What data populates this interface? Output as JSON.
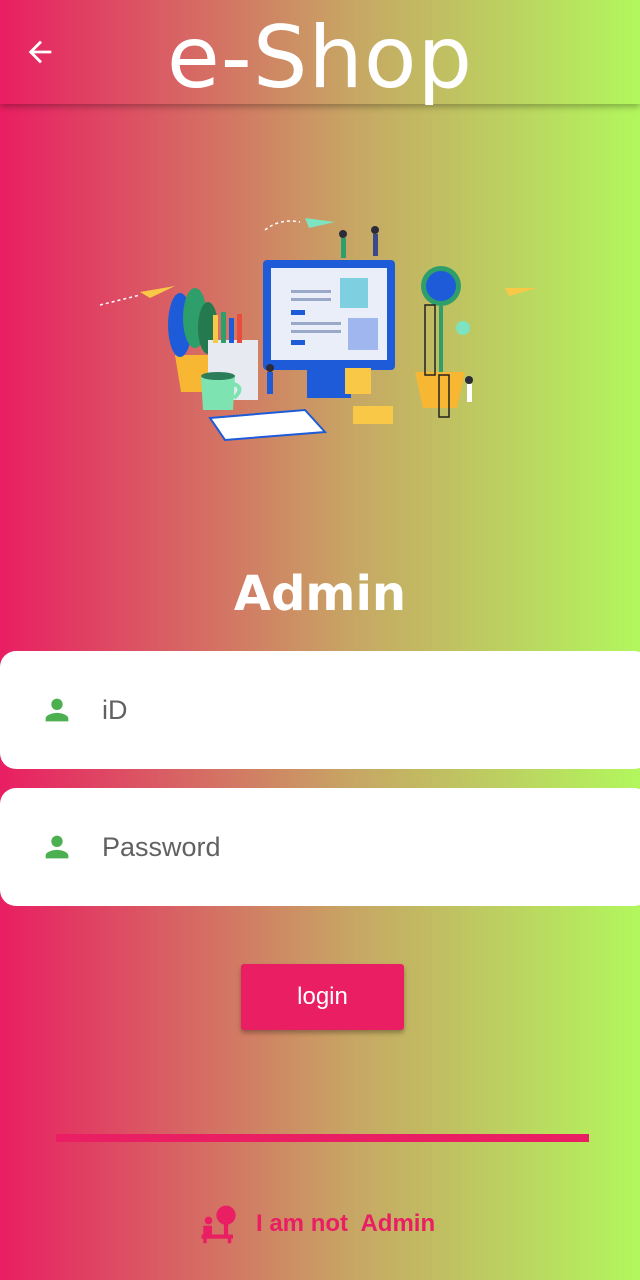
{
  "appbar": {
    "title": "e-Shop",
    "back_icon": "arrow-back-icon"
  },
  "hero": {
    "illustration": "workspace-illustration"
  },
  "page": {
    "role_title": "Admin"
  },
  "form": {
    "id_field": {
      "placeholder": "iD",
      "icon": "person-icon"
    },
    "password_field": {
      "placeholder": "Password",
      "icon": "person-icon"
    },
    "login_label": "login"
  },
  "footer": {
    "switch_label": "I am not  Admin",
    "switch_icon": "person-desk-icon"
  },
  "colors": {
    "primary": "#e91e63",
    "gradient_start": "#e91e63",
    "gradient_end": "#b2f75d",
    "icon_green": "#4caf50"
  }
}
